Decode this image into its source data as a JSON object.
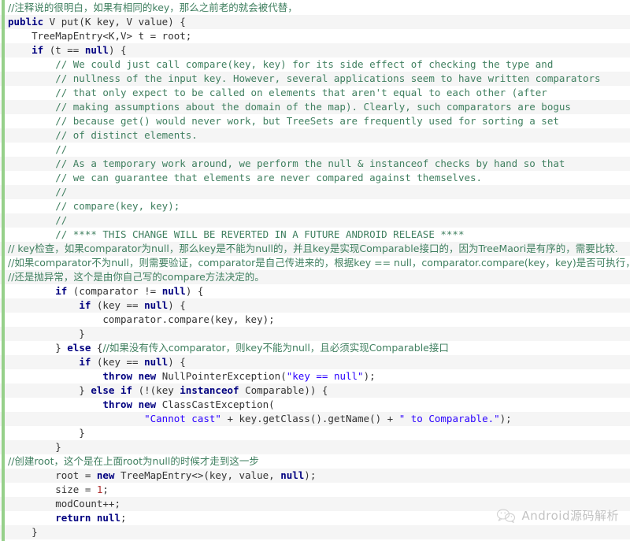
{
  "editor": {
    "language": "java",
    "accent_color": "#96d08a",
    "background_color": "#ffffff",
    "alt_row_color": "#f5f5f5",
    "keyword_color": "#000080",
    "comment_color": "#3f7f5f",
    "string_color": "#2a00ff",
    "number_color": "#b03030"
  },
  "watermark": {
    "icon": "wechat-logo-icon",
    "text": "Android源码解析"
  },
  "lines": [
    {
      "n": 1,
      "indent": 0,
      "tokens": [
        {
          "t": "cmcn",
          "v": "//注释说的很明白，如果有相同的key，那么之前老的就会被代替，"
        }
      ]
    },
    {
      "n": 2,
      "indent": 0,
      "tokens": [
        {
          "t": "kw",
          "v": "public"
        },
        {
          "t": "pl",
          "v": " V put(K key, V value) {"
        }
      ]
    },
    {
      "n": 3,
      "indent": 0,
      "tokens": [
        {
          "t": "pl",
          "v": "    TreeMapEntry<K,V> t = root;"
        }
      ]
    },
    {
      "n": 4,
      "indent": 0,
      "tokens": [
        {
          "t": "pl",
          "v": "    "
        },
        {
          "t": "kw",
          "v": "if"
        },
        {
          "t": "pl",
          "v": " (t == "
        },
        {
          "t": "kw",
          "v": "null"
        },
        {
          "t": "pl",
          "v": ") {"
        }
      ]
    },
    {
      "n": 5,
      "indent": 0,
      "tokens": [
        {
          "t": "cm",
          "v": "        // We could just call compare(key, key) for its side effect of checking the type and"
        }
      ]
    },
    {
      "n": 6,
      "indent": 0,
      "tokens": [
        {
          "t": "cm",
          "v": "        // nullness of the input key. However, several applications seem to have written comparators"
        }
      ]
    },
    {
      "n": 7,
      "indent": 0,
      "tokens": [
        {
          "t": "cm",
          "v": "        // that only expect to be called on elements that aren't equal to each other (after"
        }
      ]
    },
    {
      "n": 8,
      "indent": 0,
      "tokens": [
        {
          "t": "cm",
          "v": "        // making assumptions about the domain of the map). Clearly, such comparators are bogus"
        }
      ]
    },
    {
      "n": 9,
      "indent": 0,
      "tokens": [
        {
          "t": "cm",
          "v": "        // because get() would never work, but TreeSets are frequently used for sorting a set"
        }
      ]
    },
    {
      "n": 10,
      "indent": 0,
      "tokens": [
        {
          "t": "cm",
          "v": "        // of distinct elements."
        }
      ]
    },
    {
      "n": 11,
      "indent": 0,
      "tokens": [
        {
          "t": "cm",
          "v": "        //"
        }
      ]
    },
    {
      "n": 12,
      "indent": 0,
      "tokens": [
        {
          "t": "cm",
          "v": "        // As a temporary work around, we perform the null & instanceof checks by hand so that"
        }
      ]
    },
    {
      "n": 13,
      "indent": 0,
      "tokens": [
        {
          "t": "cm",
          "v": "        // we can guarantee that elements are never compared against themselves."
        }
      ]
    },
    {
      "n": 14,
      "indent": 0,
      "tokens": [
        {
          "t": "cm",
          "v": "        //"
        }
      ]
    },
    {
      "n": 15,
      "indent": 0,
      "tokens": [
        {
          "t": "cm",
          "v": "        // compare(key, key);"
        }
      ]
    },
    {
      "n": 16,
      "indent": 0,
      "tokens": [
        {
          "t": "cm",
          "v": "        //"
        }
      ]
    },
    {
      "n": 17,
      "indent": 0,
      "tokens": [
        {
          "t": "cm",
          "v": "        // **** THIS CHANGE WILL BE REVERTED IN A FUTURE ANDROID RELEASE ****"
        }
      ]
    },
    {
      "n": 18,
      "indent": 0,
      "tokens": [
        {
          "t": "cmcn",
          "v": "// key检查，如果comparator为null，那么key是不能为null的，并且key是实现Comparable接口的，因为TreeMaori是有序的，需要比较."
        }
      ]
    },
    {
      "n": 19,
      "indent": 0,
      "tokens": [
        {
          "t": "cmcn",
          "v": "//如果comparator不为null，则需要验证，comparator是自己传进来的，根据key == null，comparator.compare(key，key)是否可执行，"
        }
      ]
    },
    {
      "n": 20,
      "indent": 0,
      "tokens": [
        {
          "t": "cmcn",
          "v": "//还是抛异常，这个是由你自己写的compare方法决定的。"
        }
      ]
    },
    {
      "n": 21,
      "indent": 0,
      "tokens": [
        {
          "t": "pl",
          "v": "        "
        },
        {
          "t": "kw",
          "v": "if"
        },
        {
          "t": "pl",
          "v": " (comparator != "
        },
        {
          "t": "kw",
          "v": "null"
        },
        {
          "t": "pl",
          "v": ") {"
        }
      ]
    },
    {
      "n": 22,
      "indent": 0,
      "tokens": [
        {
          "t": "pl",
          "v": "            "
        },
        {
          "t": "kw",
          "v": "if"
        },
        {
          "t": "pl",
          "v": " (key == "
        },
        {
          "t": "kw",
          "v": "null"
        },
        {
          "t": "pl",
          "v": ") {"
        }
      ]
    },
    {
      "n": 23,
      "indent": 0,
      "tokens": [
        {
          "t": "pl",
          "v": "                comparator.compare(key, key);"
        }
      ]
    },
    {
      "n": 24,
      "indent": 0,
      "tokens": [
        {
          "t": "pl",
          "v": "            }"
        }
      ]
    },
    {
      "n": 25,
      "indent": 0,
      "tokens": [
        {
          "t": "pl",
          "v": "        } "
        },
        {
          "t": "kw",
          "v": "else"
        },
        {
          "t": "pl",
          "v": " {"
        },
        {
          "t": "cmcn",
          "v": "//如果没有传入comparator，则key不能为null，且必须实现Comparable接口"
        }
      ]
    },
    {
      "n": 26,
      "indent": 0,
      "tokens": [
        {
          "t": "pl",
          "v": "            "
        },
        {
          "t": "kw",
          "v": "if"
        },
        {
          "t": "pl",
          "v": " (key == "
        },
        {
          "t": "kw",
          "v": "null"
        },
        {
          "t": "pl",
          "v": ") {"
        }
      ]
    },
    {
      "n": 27,
      "indent": 0,
      "tokens": [
        {
          "t": "pl",
          "v": "                "
        },
        {
          "t": "kw",
          "v": "throw"
        },
        {
          "t": "pl",
          "v": " "
        },
        {
          "t": "kw",
          "v": "new"
        },
        {
          "t": "pl",
          "v": " NullPointerException("
        },
        {
          "t": "str",
          "v": "\"key == null\""
        },
        {
          "t": "pl",
          "v": ");"
        }
      ]
    },
    {
      "n": 28,
      "indent": 0,
      "tokens": [
        {
          "t": "pl",
          "v": "            } "
        },
        {
          "t": "kw",
          "v": "else"
        },
        {
          "t": "pl",
          "v": " "
        },
        {
          "t": "kw",
          "v": "if"
        },
        {
          "t": "pl",
          "v": " (!(key "
        },
        {
          "t": "kw",
          "v": "instanceof"
        },
        {
          "t": "pl",
          "v": " Comparable)) {"
        }
      ]
    },
    {
      "n": 29,
      "indent": 0,
      "tokens": [
        {
          "t": "pl",
          "v": "                "
        },
        {
          "t": "kw",
          "v": "throw"
        },
        {
          "t": "pl",
          "v": " "
        },
        {
          "t": "kw",
          "v": "new"
        },
        {
          "t": "pl",
          "v": " ClassCastException("
        }
      ]
    },
    {
      "n": 30,
      "indent": 0,
      "tokens": [
        {
          "t": "pl",
          "v": "                       "
        },
        {
          "t": "str",
          "v": "\"Cannot cast\""
        },
        {
          "t": "pl",
          "v": " + key.getClass().getName() + "
        },
        {
          "t": "str",
          "v": "\" to Comparable.\""
        },
        {
          "t": "pl",
          "v": ");"
        }
      ]
    },
    {
      "n": 31,
      "indent": 0,
      "tokens": [
        {
          "t": "pl",
          "v": "            }"
        }
      ]
    },
    {
      "n": 32,
      "indent": 0,
      "tokens": [
        {
          "t": "pl",
          "v": "        }"
        }
      ]
    },
    {
      "n": 33,
      "indent": 0,
      "tokens": [
        {
          "t": "cmcn",
          "v": "//创建root，这个是在上面root为null的时候才走到这一步"
        }
      ]
    },
    {
      "n": 34,
      "indent": 0,
      "tokens": [
        {
          "t": "pl",
          "v": "        root = "
        },
        {
          "t": "kw",
          "v": "new"
        },
        {
          "t": "pl",
          "v": " TreeMapEntry<>(key, value, "
        },
        {
          "t": "kw",
          "v": "null"
        },
        {
          "t": "pl",
          "v": ");"
        }
      ]
    },
    {
      "n": 35,
      "indent": 0,
      "tokens": [
        {
          "t": "pl",
          "v": "        size = "
        },
        {
          "t": "num",
          "v": "1"
        },
        {
          "t": "pl",
          "v": ";"
        }
      ]
    },
    {
      "n": 36,
      "indent": 0,
      "tokens": [
        {
          "t": "pl",
          "v": "        modCount++;"
        }
      ]
    },
    {
      "n": 37,
      "indent": 0,
      "tokens": [
        {
          "t": "pl",
          "v": "        "
        },
        {
          "t": "kw",
          "v": "return"
        },
        {
          "t": "pl",
          "v": " "
        },
        {
          "t": "kw",
          "v": "null"
        },
        {
          "t": "pl",
          "v": ";"
        }
      ]
    },
    {
      "n": 38,
      "indent": 0,
      "tokens": [
        {
          "t": "pl",
          "v": "    }"
        }
      ]
    }
  ]
}
